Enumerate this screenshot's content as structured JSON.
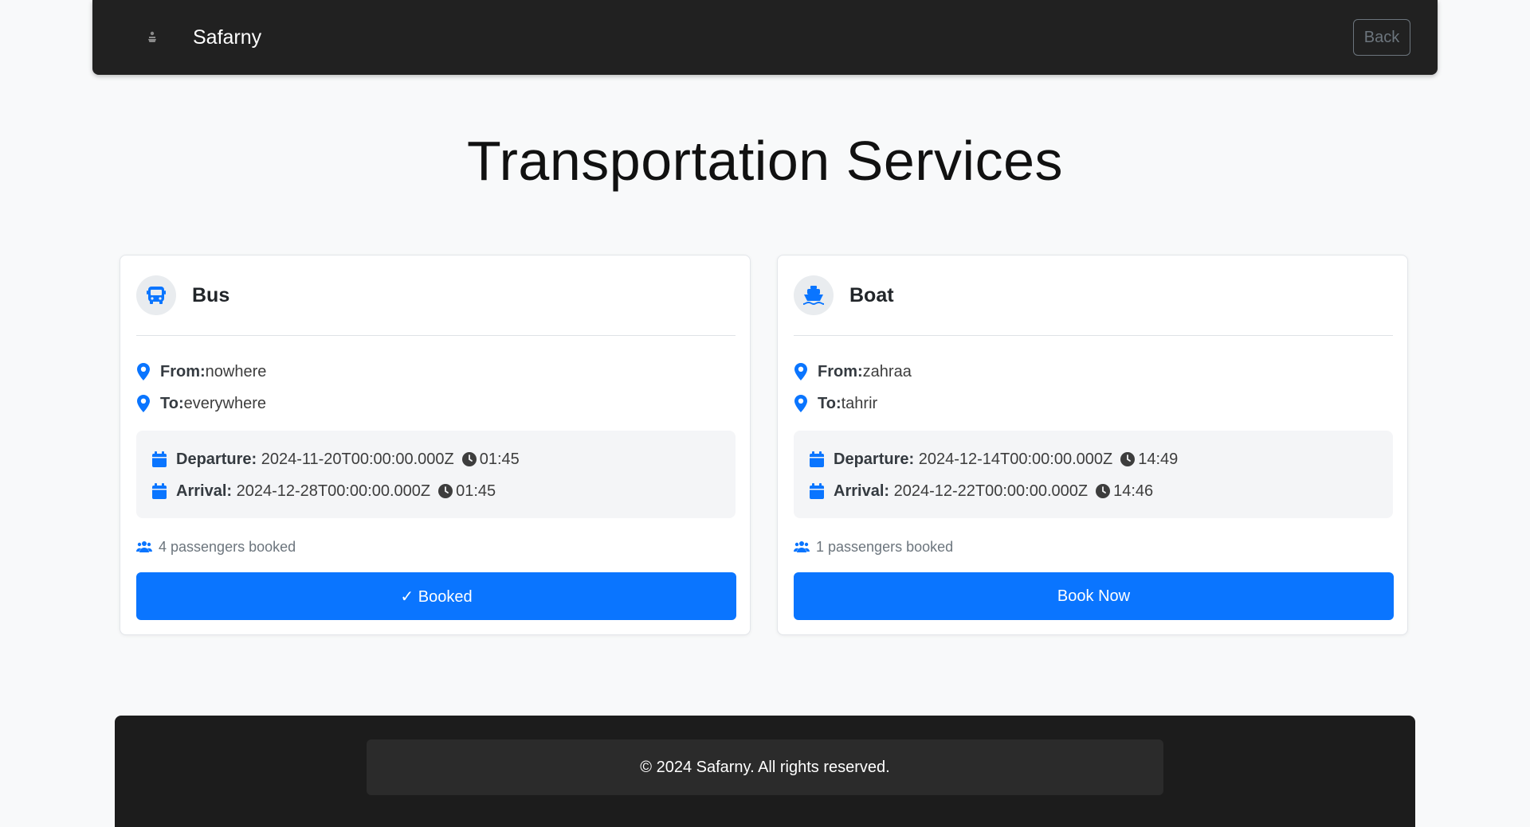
{
  "app": {
    "brand_name": "Safarny",
    "back_label": "Back"
  },
  "page": {
    "title": "Transportation Services"
  },
  "cards": [
    {
      "type": "Bus",
      "icon": "bus-icon",
      "from_label": "From:",
      "from_value": "nowhere",
      "to_label": "To:",
      "to_value": "everywhere",
      "departure_label": "Departure:",
      "departure_date": "2024-11-20T00:00:00.000Z",
      "departure_time": "01:45",
      "arrival_label": "Arrival:",
      "arrival_date": "2024-12-28T00:00:00.000Z",
      "arrival_time": "01:45",
      "passengers": "4 passengers booked",
      "button_label": "✓ Booked"
    },
    {
      "type": "Boat",
      "icon": "ship-icon",
      "from_label": "From:",
      "from_value": "zahraa",
      "to_label": "To:",
      "to_value": "tahrir",
      "departure_label": "Departure:",
      "departure_date": "2024-12-14T00:00:00.000Z",
      "departure_time": "14:49",
      "arrival_label": "Arrival:",
      "arrival_date": "2024-12-22T00:00:00.000Z",
      "arrival_time": "14:46",
      "passengers": "1 passengers booked",
      "button_label": "Book Now"
    }
  ],
  "footer": {
    "text": "© 2024 Safarny. All rights reserved."
  },
  "colors": {
    "primary": "#0a75ff",
    "navbar": "#212121",
    "footer": "#1c1c1c",
    "background": "#f8f9fa"
  }
}
